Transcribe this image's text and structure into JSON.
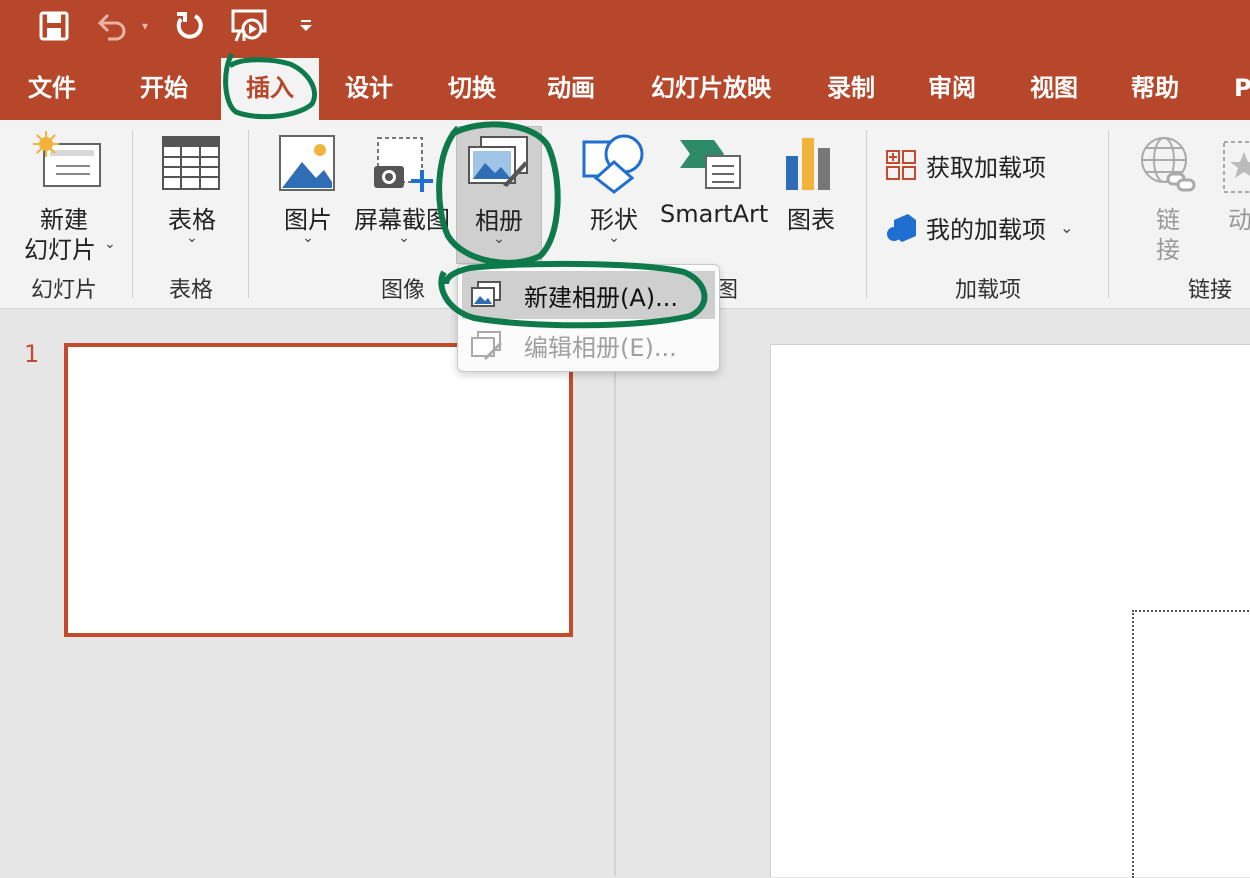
{
  "quick_access": {
    "save_icon": "save-icon",
    "undo_icon": "undo-icon",
    "undo_dropdown_icon": "chevron-down-icon",
    "redo_icon": "redo-icon",
    "start_slideshow_icon": "slideshow-icon",
    "customize_icon": "customize-dropdown-icon"
  },
  "tabs": [
    {
      "label": "文件"
    },
    {
      "label": "开始"
    },
    {
      "label": "插入",
      "active": true
    },
    {
      "label": "设计"
    },
    {
      "label": "切换"
    },
    {
      "label": "动画"
    },
    {
      "label": "幻灯片放映"
    },
    {
      "label": "录制"
    },
    {
      "label": "审阅"
    },
    {
      "label": "视图"
    },
    {
      "label": "帮助"
    },
    {
      "label": "P"
    }
  ],
  "ribbon": {
    "new_slide": {
      "line1": "新建",
      "line2": "幻灯片"
    },
    "table": {
      "label": "表格"
    },
    "pictures": {
      "label": "图片"
    },
    "screenshot": {
      "label": "屏幕截图"
    },
    "photo_album": {
      "label": "相册"
    },
    "shapes": {
      "label": "形状"
    },
    "smartart": {
      "label": "SmartArt"
    },
    "chart": {
      "label": "图表"
    },
    "get_addins": {
      "label": "获取加载项"
    },
    "my_addins": {
      "label": "我的加载项"
    },
    "link": {
      "line1": "链",
      "line2": "接"
    },
    "action": {
      "label": "动"
    },
    "groups": {
      "slides": "幻灯片",
      "tables": "表格",
      "images": "图像",
      "illustrations_tail": "图",
      "addins": "加载项",
      "links": "链接"
    }
  },
  "dropdown_menu": {
    "items": [
      {
        "label": "新建相册(A)...",
        "enabled": true,
        "highlighted": true
      },
      {
        "label": "编辑相册(E)...",
        "enabled": false
      }
    ]
  },
  "slide_thumbnails": [
    {
      "number": "1",
      "selected": true
    }
  ],
  "colors": {
    "accent": "#b7472a",
    "ribbon_bg": "#f3f3f3",
    "workspace_bg": "#e6e6e6",
    "annotation_green": "#0e7a4c"
  }
}
